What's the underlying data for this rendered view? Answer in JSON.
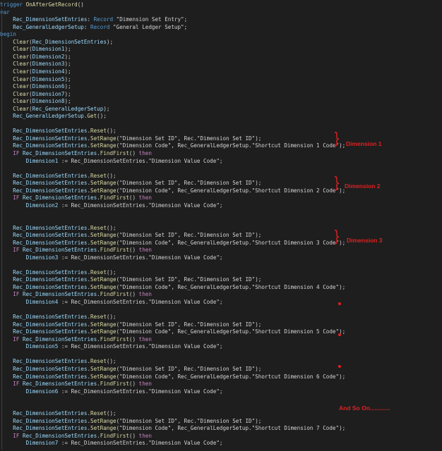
{
  "header": [
    {
      "spans": [
        {
          "c": "kw",
          "t": "trigger "
        },
        {
          "c": "fn",
          "t": "OnAfterGetRecord"
        },
        {
          "c": "pun",
          "t": "()"
        }
      ]
    },
    {
      "spans": [
        {
          "c": "kw",
          "t": "var"
        }
      ]
    },
    {
      "spans": [
        {
          "c": "var",
          "t": "    Rec_DimensionSetEntries"
        },
        {
          "c": "pun",
          "t": ": "
        },
        {
          "c": "kw",
          "t": "Record "
        },
        {
          "c": "pun",
          "t": "\"Dimension Set Entry\";"
        }
      ]
    },
    {
      "spans": [
        {
          "c": "var",
          "t": "    Rec_GeneralLedgerSetup"
        },
        {
          "c": "pun",
          "t": ": "
        },
        {
          "c": "kw",
          "t": "Record "
        },
        {
          "c": "pun",
          "t": "\"General Ledger Setup\";"
        }
      ]
    },
    {
      "spans": [
        {
          "c": "kw",
          "t": "begin"
        }
      ]
    },
    {
      "spans": [
        {
          "c": "fn",
          "t": "    Clear"
        },
        {
          "c": "pun",
          "t": "("
        },
        {
          "c": "var",
          "t": "Rec_DimensionSetEntries"
        },
        {
          "c": "pun",
          "t": ");"
        }
      ]
    },
    {
      "spans": [
        {
          "c": "fn",
          "t": "    Clear"
        },
        {
          "c": "pun",
          "t": "("
        },
        {
          "c": "var",
          "t": "Dimension1"
        },
        {
          "c": "pun",
          "t": ");"
        }
      ]
    },
    {
      "spans": [
        {
          "c": "fn",
          "t": "    Clear"
        },
        {
          "c": "pun",
          "t": "("
        },
        {
          "c": "var",
          "t": "Dimension2"
        },
        {
          "c": "pun",
          "t": ");"
        }
      ]
    },
    {
      "spans": [
        {
          "c": "fn",
          "t": "    Clear"
        },
        {
          "c": "pun",
          "t": "("
        },
        {
          "c": "var",
          "t": "Dimension3"
        },
        {
          "c": "pun",
          "t": ");"
        }
      ]
    },
    {
      "spans": [
        {
          "c": "fn",
          "t": "    Clear"
        },
        {
          "c": "pun",
          "t": "("
        },
        {
          "c": "var",
          "t": "Dimension4"
        },
        {
          "c": "pun",
          "t": ");"
        }
      ]
    },
    {
      "spans": [
        {
          "c": "fn",
          "t": "    Clear"
        },
        {
          "c": "pun",
          "t": "("
        },
        {
          "c": "var",
          "t": "Dimension5"
        },
        {
          "c": "pun",
          "t": ");"
        }
      ]
    },
    {
      "spans": [
        {
          "c": "fn",
          "t": "    Clear"
        },
        {
          "c": "pun",
          "t": "("
        },
        {
          "c": "var",
          "t": "Dimension6"
        },
        {
          "c": "pun",
          "t": ");"
        }
      ]
    },
    {
      "spans": [
        {
          "c": "fn",
          "t": "    Clear"
        },
        {
          "c": "pun",
          "t": "("
        },
        {
          "c": "var",
          "t": "Dimension7"
        },
        {
          "c": "pun",
          "t": ");"
        }
      ]
    },
    {
      "spans": [
        {
          "c": "fn",
          "t": "    Clear"
        },
        {
          "c": "pun",
          "t": "("
        },
        {
          "c": "var",
          "t": "Dimension8"
        },
        {
          "c": "pun",
          "t": ");"
        }
      ]
    },
    {
      "spans": [
        {
          "c": "fn",
          "t": "    Clear"
        },
        {
          "c": "pun",
          "t": "("
        },
        {
          "c": "var",
          "t": "Rec_GeneralLedgerSetup"
        },
        {
          "c": "pun",
          "t": ");"
        }
      ]
    },
    {
      "spans": [
        {
          "c": "var",
          "t": "    Rec_GeneralLedgerSetup"
        },
        {
          "c": "pun",
          "t": "."
        },
        {
          "c": "fn",
          "t": "Get"
        },
        {
          "c": "pun",
          "t": "();"
        }
      ]
    }
  ],
  "blocks": [
    {
      "dim": "1",
      "shortcut": "\"Shortcut Dimension 1 Code\");",
      "target": "Dimension1"
    },
    {
      "dim": "2",
      "shortcut": "\"Shortcut Dimension 2 Code\");",
      "target": "Dimension2"
    },
    {
      "dim": "3",
      "shortcut": "\"Shortcut Dimension 3 Code\");",
      "target": "Dimension3"
    },
    {
      "dim": "4",
      "shortcut": "\"Shortcut Dimension 4 Code\");",
      "target": "Dimension4"
    },
    {
      "dim": "5",
      "shortcut": "\"Shortcut Dimension 5 Code\");",
      "target": "Dimension5"
    },
    {
      "dim": "6",
      "shortcut": "\"Shortcut Dimension 6 Code\");",
      "target": "Dimension6"
    },
    {
      "dim": "7",
      "shortcut": "\"Shortcut Dimension 7 Code\");",
      "target": "Dimension7"
    }
  ],
  "tokens": {
    "rec": "Rec_DimensionSetEntries",
    "reset": "Reset",
    "setrange": "SetRange",
    "findfirst": "FindFirst",
    "if": "IF ",
    "then": " then",
    "setid": "\"Dimension Set ID\", Rec.\"Dimension Set ID\");",
    "dimcode": "\"Dimension Code\", Rec_GeneralLedgerSetup.",
    "assign": " := Rec_DimensionSetEntries.\"Dimension Value Code\";"
  },
  "annotations": {
    "dim1": "Dimension 1",
    "dim2": "Dimension 2",
    "dim3": "Dimension 3",
    "more": "And So On............"
  },
  "colors": {
    "annotation": "#e02020",
    "background": "#1e1e1e"
  }
}
